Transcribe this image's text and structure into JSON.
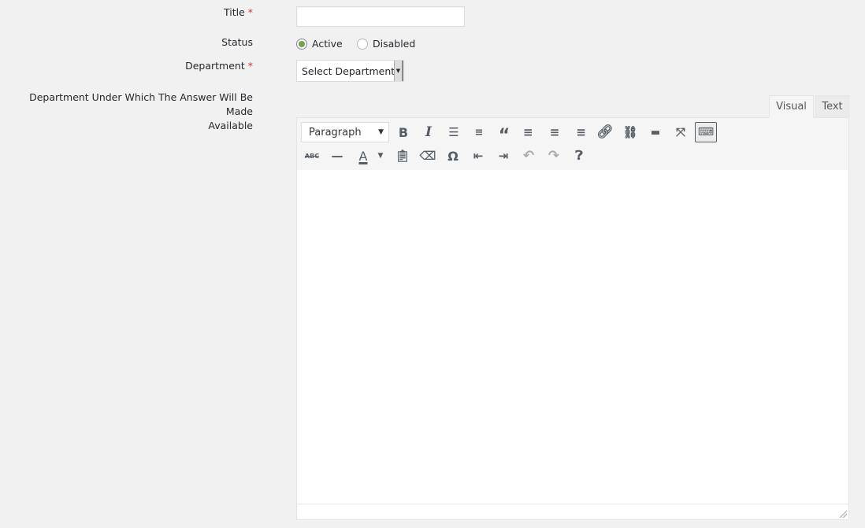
{
  "form": {
    "title_label": "Title",
    "required_mark": "*",
    "title_value": "",
    "status_label": "Status",
    "status_options": [
      {
        "label": "Active",
        "checked": true
      },
      {
        "label": "Disabled",
        "checked": false
      }
    ],
    "department_label": "Department",
    "department_select": "Select Department",
    "answer_label_line1": "Department Under Which The Answer Will Be Made",
    "answer_label_line2": "Available"
  },
  "editor": {
    "tabs": [
      {
        "label": "Visual",
        "active": true
      },
      {
        "label": "Text",
        "active": false
      }
    ],
    "format_select": "Paragraph",
    "row1": [
      "bold-icon",
      "italic-icon",
      "bullet-list-icon",
      "numbered-list-icon",
      "blockquote-icon",
      "align-left-icon",
      "align-center-icon",
      "align-right-icon",
      "link-icon",
      "unlink-icon",
      "read-more-icon",
      "fullscreen-icon",
      "toolbar-toggle-icon"
    ],
    "row2": [
      "strikethrough-icon",
      "horizontal-line-icon",
      "text-color-icon",
      "paste-text-icon",
      "clear-formatting-icon",
      "special-character-icon",
      "outdent-icon",
      "indent-icon",
      "undo-icon",
      "redo-icon",
      "help-icon"
    ],
    "content": ""
  },
  "colors": {
    "required": "#dc3232",
    "radio_checked": "#6fa34a"
  }
}
